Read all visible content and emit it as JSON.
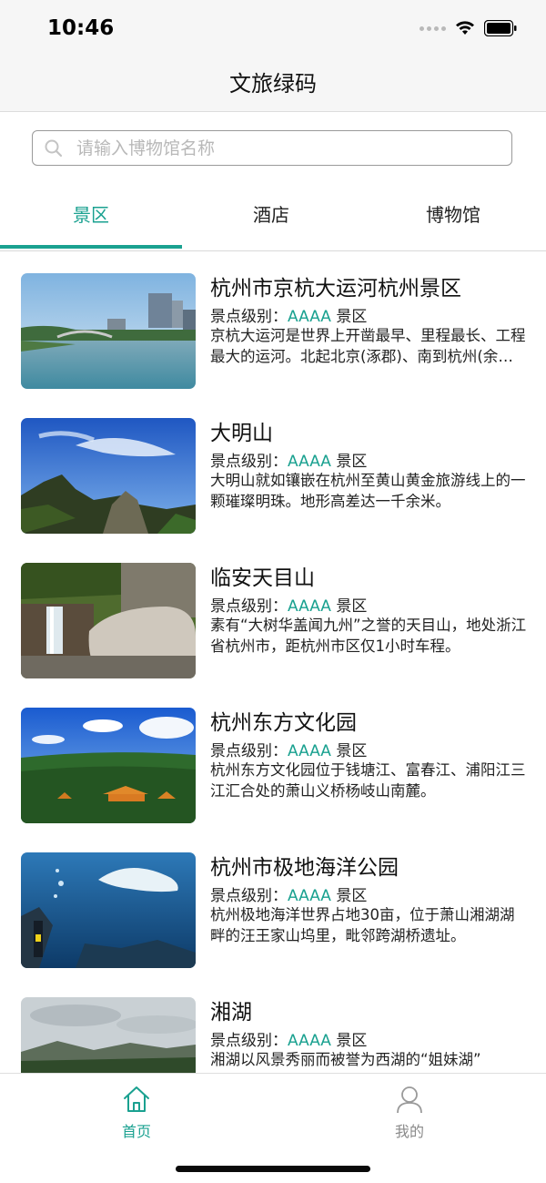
{
  "status_bar": {
    "time": "10:46"
  },
  "nav": {
    "title": "文旅绿码"
  },
  "search": {
    "placeholder": "请输入博物馆名称",
    "value": ""
  },
  "tabs": [
    {
      "label": "景区",
      "active": true
    },
    {
      "label": "酒店",
      "active": false
    },
    {
      "label": "博物馆",
      "active": false
    }
  ],
  "level_prefix": "景点级别：",
  "scenic_spots": [
    {
      "name": "杭州市京杭大运河杭州景区",
      "level": "AAAA",
      "level_suffix": "景区",
      "desc": "京杭大运河是世界上开凿最早、里程最长、工程最大的运河。北起北京(涿郡)、南到杭州(余杭)。"
    },
    {
      "name": "大明山",
      "level": "AAAA",
      "level_suffix": "景区",
      "desc": "大明山就如镶嵌在杭州至黄山黄金旅游线上的一颗璀璨明珠。地形高差达一千余米。"
    },
    {
      "name": "临安天目山",
      "level": "AAAA",
      "level_suffix": "景区",
      "desc": "素有“大树华盖闻九州”之誉的天目山，地处浙江省杭州市，距杭州市区仅1小时车程。"
    },
    {
      "name": "杭州东方文化园",
      "level": "AAAA",
      "level_suffix": "景区",
      "desc": "杭州东方文化园位于钱塘江、富春江、浦阳江三江汇合处的萧山义桥杨岐山南麓。"
    },
    {
      "name": "杭州市极地海洋公园",
      "level": "AAAA",
      "level_suffix": "景区",
      "desc": "杭州极地海洋世界占地30亩，位于萧山湘湖湖畔的汪王家山坞里，毗邻跨湖桥遗址。"
    },
    {
      "name": "湘湖",
      "level": "AAAA",
      "level_suffix": "景区",
      "desc": "湘湖以风景秀丽而被誉为西湖的“姐妹湖”"
    }
  ],
  "tab_bar": [
    {
      "label": "首页",
      "icon": "home-icon",
      "active": true
    },
    {
      "label": "我的",
      "icon": "user-icon",
      "active": false
    }
  ],
  "colors": {
    "accent": "#1aa190",
    "inactive": "#9a9a9a"
  }
}
